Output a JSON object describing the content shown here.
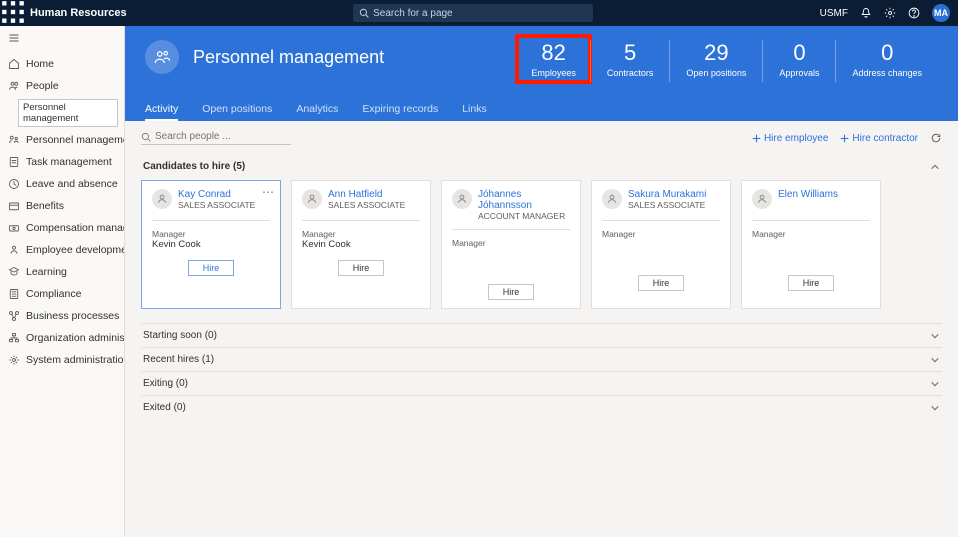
{
  "topbar": {
    "app_title": "Human Resources",
    "search_placeholder": "Search for a page",
    "env": "USMF",
    "avatar_initials": "MA"
  },
  "nav": {
    "items": [
      {
        "label": "Home",
        "icon": "home"
      },
      {
        "label": "People",
        "icon": "people"
      },
      {
        "label": "Personnel management",
        "icon": "personnel",
        "chip": true
      },
      {
        "label": "Task management",
        "icon": "task"
      },
      {
        "label": "Leave and absence",
        "icon": "leave"
      },
      {
        "label": "Benefits",
        "icon": "benefits"
      },
      {
        "label": "Compensation management",
        "icon": "comp"
      },
      {
        "label": "Employee development",
        "icon": "dev"
      },
      {
        "label": "Learning",
        "icon": "learn"
      },
      {
        "label": "Compliance",
        "icon": "compliance"
      },
      {
        "label": "Business processes",
        "icon": "proc"
      },
      {
        "label": "Organization administration",
        "icon": "org"
      },
      {
        "label": "System administration",
        "icon": "sys"
      }
    ],
    "chip_label": "Personnel management"
  },
  "hero": {
    "title": "Personnel management",
    "stats": [
      {
        "value": "82",
        "label": "Employees",
        "highlight": true
      },
      {
        "value": "5",
        "label": "Contractors"
      },
      {
        "value": "29",
        "label": "Open positions"
      },
      {
        "value": "0",
        "label": "Approvals"
      },
      {
        "value": "0",
        "label": "Address changes"
      }
    ],
    "tabs": [
      "Activity",
      "Open positions",
      "Analytics",
      "Expiring records",
      "Links"
    ],
    "active_tab": 0
  },
  "content": {
    "search_placeholder": "Search people ...",
    "hire_employee": "Hire employee",
    "hire_contractor": "Hire contractor",
    "candidates_title": "Candidates to hire (5)",
    "manager_label": "Manager",
    "hire_btn": "Hire",
    "candidates": [
      {
        "name": "Kay Conrad",
        "role": "SALES ASSOCIATE",
        "manager": "Kevin Cook",
        "active": true
      },
      {
        "name": "Ann Hatfield",
        "role": "SALES ASSOCIATE",
        "manager": "Kevin Cook"
      },
      {
        "name": "Jóhannes Jóhannsson",
        "role": "ACCOUNT MANAGER",
        "manager": ""
      },
      {
        "name": "Sakura Murakami",
        "role": "SALES ASSOCIATE",
        "manager": ""
      },
      {
        "name": "Elen Williams",
        "role": "",
        "manager": ""
      }
    ],
    "sections": [
      {
        "title": "Starting soon (0)"
      },
      {
        "title": "Recent hires (1)"
      },
      {
        "title": "Exiting (0)"
      },
      {
        "title": "Exited (0)"
      }
    ]
  }
}
